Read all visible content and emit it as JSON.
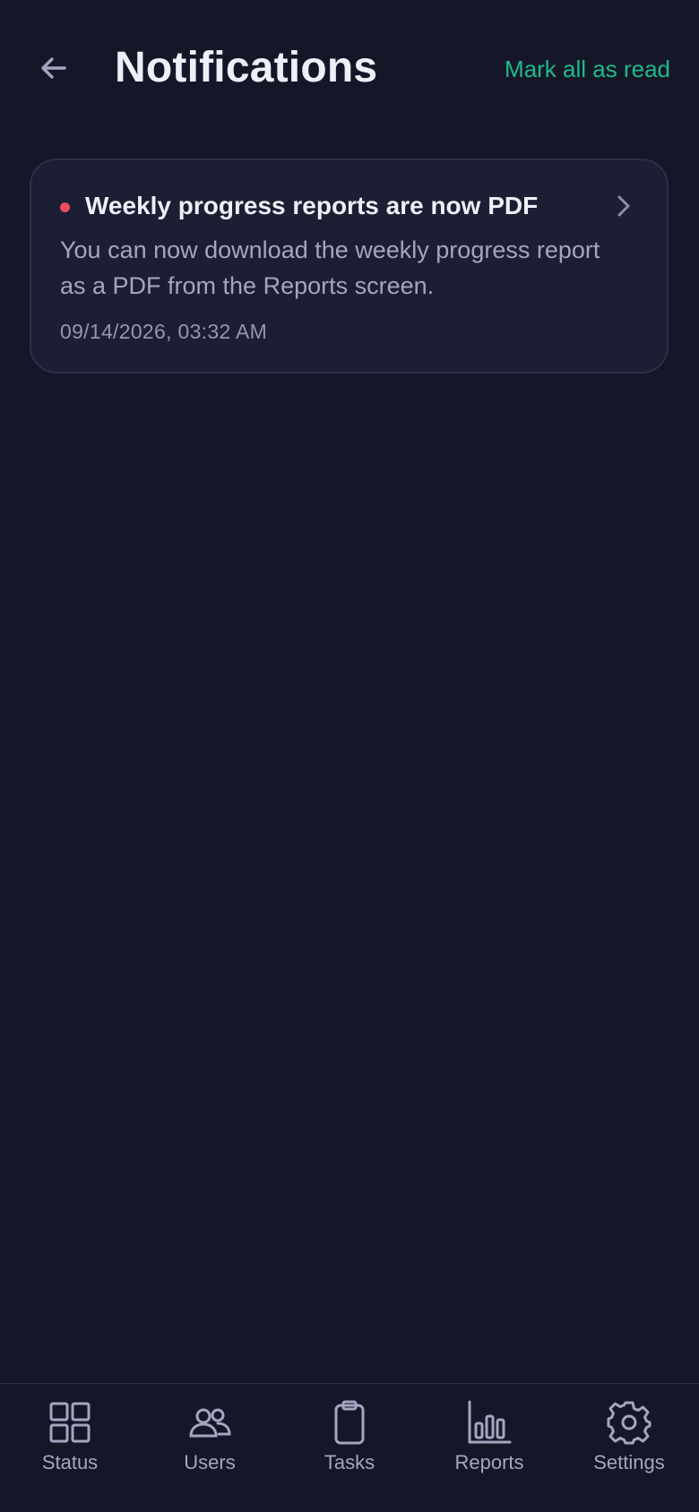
{
  "header": {
    "title": "Notifications",
    "mark_all_label": "Mark all as read",
    "back_icon": "arrow-left-icon"
  },
  "notifications": [
    {
      "title": "Weekly progress reports are now PDF",
      "body": "You can now download the weekly progress report as a PDF from the Reports screen.",
      "timestamp": "09/14/2026, 03:32 AM",
      "unread": true
    }
  ],
  "bottom_nav": {
    "items": [
      {
        "label": "Status",
        "icon": "grid-icon"
      },
      {
        "label": "Users",
        "icon": "users-icon"
      },
      {
        "label": "Tasks",
        "icon": "clipboard-icon"
      },
      {
        "label": "Reports",
        "icon": "bar-chart-icon"
      },
      {
        "label": "Settings",
        "icon": "gear-icon"
      }
    ]
  },
  "colors": {
    "background": "#151729",
    "card": "#1C1E33",
    "accent": "#1FB98A",
    "unread_dot": "#EF4A5E",
    "muted_text": "#A3A6BF"
  }
}
